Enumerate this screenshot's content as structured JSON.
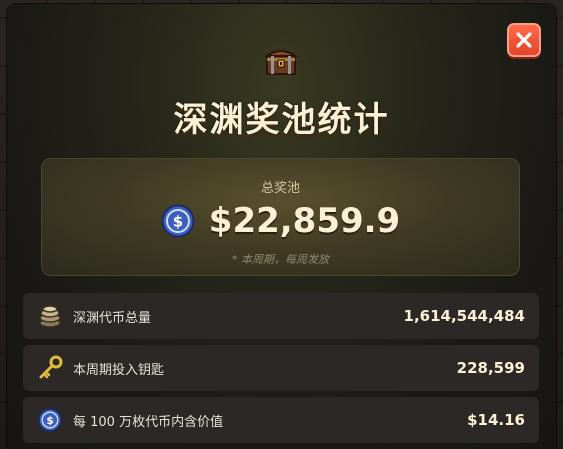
{
  "modal": {
    "title": "深渊奖池统计",
    "close_icon": "close-icon",
    "header_icon": "treasure-chest-icon"
  },
  "pool": {
    "label": "总奖池",
    "amount": "$22,859.9",
    "note": "* 本周期，每周发放",
    "coin_icon": "abyss-coin-icon"
  },
  "stats": [
    {
      "icon": "coin-stack-icon",
      "label": "深渊代币总量",
      "value": "1,614,544,484"
    },
    {
      "icon": "golden-key-icon",
      "label": "本周期投入钥匙",
      "value": "228,599"
    },
    {
      "icon": "abyss-coin-icon",
      "label": "每 100 万枚代币内含价值",
      "value": "$14.16"
    }
  ],
  "colors": {
    "accent_close": "#e2452a",
    "title_text": "#fbf1d6",
    "panel_bg": "#2b2825"
  }
}
